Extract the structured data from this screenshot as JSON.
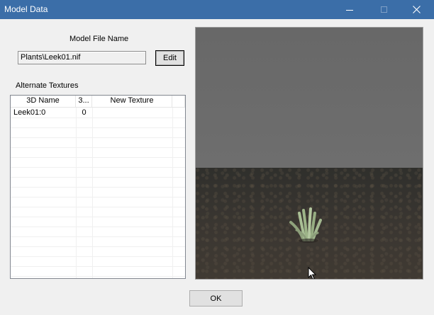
{
  "window": {
    "title": "Model Data",
    "titlebar_color": "#3b6ea8"
  },
  "model_file": {
    "label": "Model File Name",
    "value": "Plants\\Leek01.nif",
    "edit_label": "Edit"
  },
  "textures": {
    "label": "Alternate Textures",
    "columns": [
      "3D Name",
      "3...",
      "New Texture"
    ],
    "rows": [
      {
        "name": "Leek01:0",
        "index": "0",
        "new_texture": ""
      }
    ]
  },
  "preview": {
    "description": "3D preview viewport",
    "plant_color": "#9fb78c"
  },
  "footer": {
    "ok_label": "OK"
  },
  "icons": {
    "minimize": "minimize-icon",
    "maximize": "maximize-icon",
    "close": "close-icon"
  }
}
